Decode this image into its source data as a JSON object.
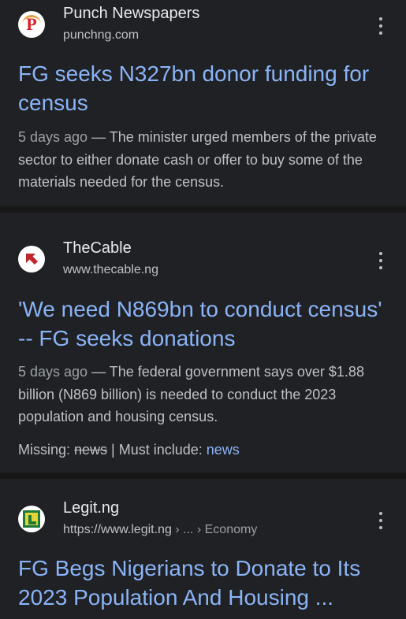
{
  "results": [
    {
      "source_name": "Punch Newspapers",
      "source_url": "punchng.com",
      "favicon_letter": "P",
      "title": "FG seeks N327bn donor funding for census",
      "date": "5 days ago",
      "separator": " — ",
      "snippet": "The minister urged members of the private sector to either donate cash or offer to buy some of the materials needed for the census."
    },
    {
      "source_name": "TheCable",
      "source_url": "www.thecable.ng",
      "title": "'We need N869bn to conduct census' -- FG seeks donations",
      "date": "5 days ago",
      "separator": " — ",
      "snippet": "The federal government says over $1.88 billion (N869 billion) is needed to conduct the 2023 population and housing census.",
      "missing_label": "Missing: ",
      "missing_term": "news",
      "must_include_label": " | Must include: ",
      "must_include_term": "news"
    },
    {
      "source_name": "Legit.ng",
      "source_url": "https://www.legit.ng",
      "source_breadcrumb": " › ... › Economy",
      "title": "FG Begs Nigerians to Donate to Its 2023 Population And Housing ..."
    }
  ],
  "colors": {
    "background": "#202124",
    "divider": "#171717",
    "link": "#8ab4f8",
    "text": "#bdc1c6",
    "punch_red": "#d81f26",
    "thecable_red": "#c0272d",
    "legit_green": "#1f7a3a",
    "legit_yellow": "#e3d437"
  },
  "icons": {
    "menu": "more-vert-icon"
  }
}
